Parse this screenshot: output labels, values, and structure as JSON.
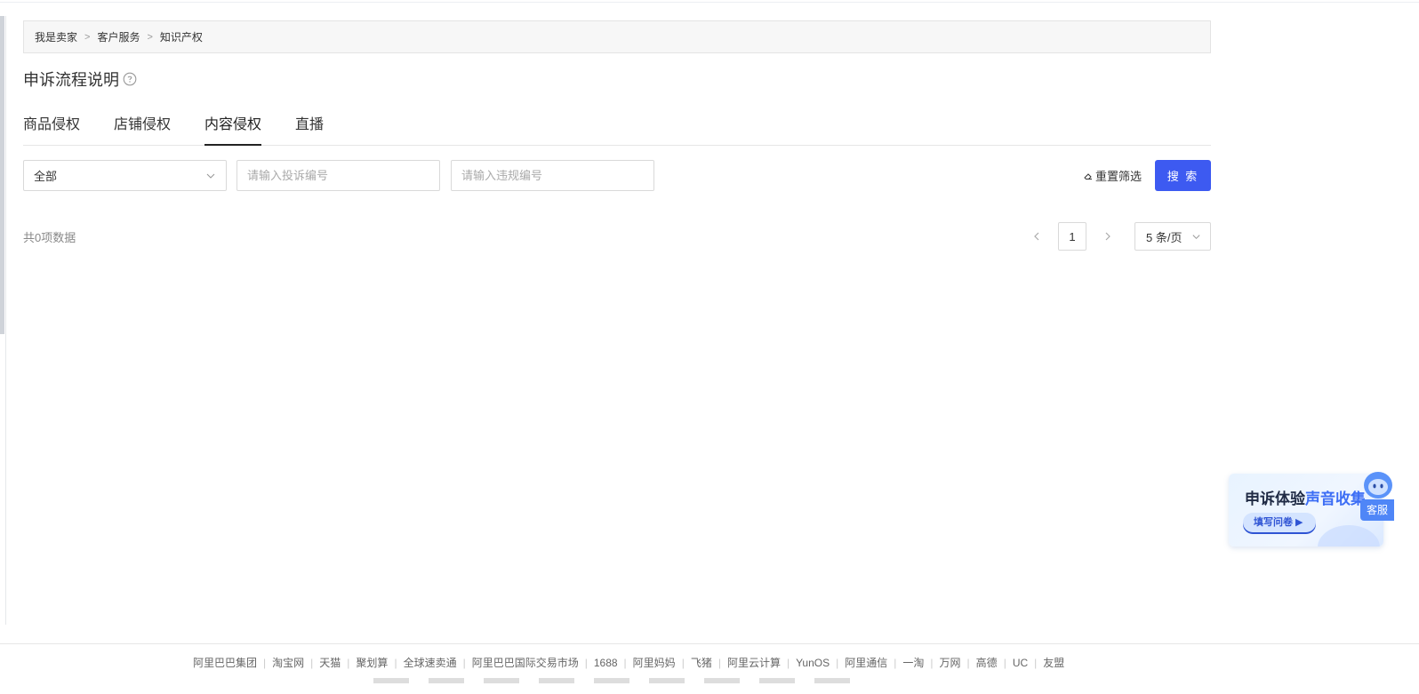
{
  "breadcrumb": [
    "我是卖家",
    "客户服务",
    "知识产权"
  ],
  "breadcrumb_separator": ">",
  "page_title": "申诉流程说明",
  "tabs": [
    {
      "label": "商品侵权",
      "active": false
    },
    {
      "label": "店铺侵权",
      "active": false
    },
    {
      "label": "内容侵权",
      "active": true
    },
    {
      "label": "直播",
      "active": false
    }
  ],
  "filters": {
    "status_select": "全部",
    "complaint_placeholder": "请输入投诉编号",
    "violation_placeholder": "请输入违规编号",
    "reset_label": "重置筛选",
    "search_label": "搜 索"
  },
  "results": {
    "total_text": "共0项数据",
    "current_page": "1",
    "page_size": "5 条/页"
  },
  "promo": {
    "title_main": "申诉体验",
    "title_highlight": "声音收集",
    "button": "填写问卷 ▶"
  },
  "customer_service": "客服",
  "footer": {
    "links": [
      "阿里巴巴集团",
      "淘宝网",
      "天猫",
      "聚划算",
      "全球速卖通",
      "阿里巴巴国际交易市场",
      "1688",
      "阿里妈妈",
      "飞猪",
      "阿里云计算",
      "YunOS",
      "阿里通信",
      "一淘",
      "万网",
      "高德",
      "UC",
      "友盟"
    ]
  },
  "colors": {
    "primary": "#3d5af1",
    "border": "#d9d9d9",
    "breadcrumb_bg": "#f7f7f7"
  }
}
